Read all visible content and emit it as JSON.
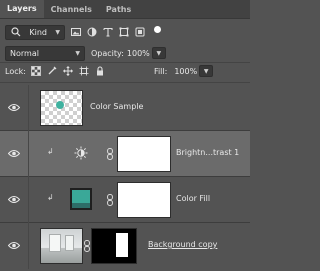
{
  "tabs": [
    {
      "label": "Layers",
      "active": true
    },
    {
      "label": "Channels",
      "active": false
    },
    {
      "label": "Paths",
      "active": false
    }
  ],
  "filter": {
    "kind_label": "Kind",
    "icons": [
      "search-icon",
      "image-filter-icon",
      "adjustment-filter-icon",
      "type-filter-icon",
      "shape-filter-icon",
      "smart-object-filter-icon"
    ]
  },
  "blend": {
    "mode": "Normal",
    "opacity_label": "Opacity:",
    "opacity_value": "100%"
  },
  "lock": {
    "label": "Lock:",
    "icons": [
      "lock-transparent-icon",
      "lock-image-icon",
      "lock-position-icon",
      "lock-artboard-icon",
      "lock-all-icon"
    ],
    "fill_label": "Fill:",
    "fill_value": "100%"
  },
  "layers": [
    {
      "name": "Color Sample",
      "visible": true,
      "selected": false,
      "type": "pixel"
    },
    {
      "name": "Brightn...trast 1",
      "visible": true,
      "selected": true,
      "type": "adjustment",
      "clipped": true
    },
    {
      "name": "Color Fill",
      "visible": true,
      "selected": false,
      "type": "fill",
      "clipped": true,
      "swatch_color": "#3aa898"
    },
    {
      "name": "Background copy",
      "visible": true,
      "selected": false,
      "type": "pixel-with-mask"
    }
  ],
  "colors": {
    "panel_bg": "#535353",
    "selected_row": "#6b6b6b",
    "teal": "#3fb19f"
  }
}
